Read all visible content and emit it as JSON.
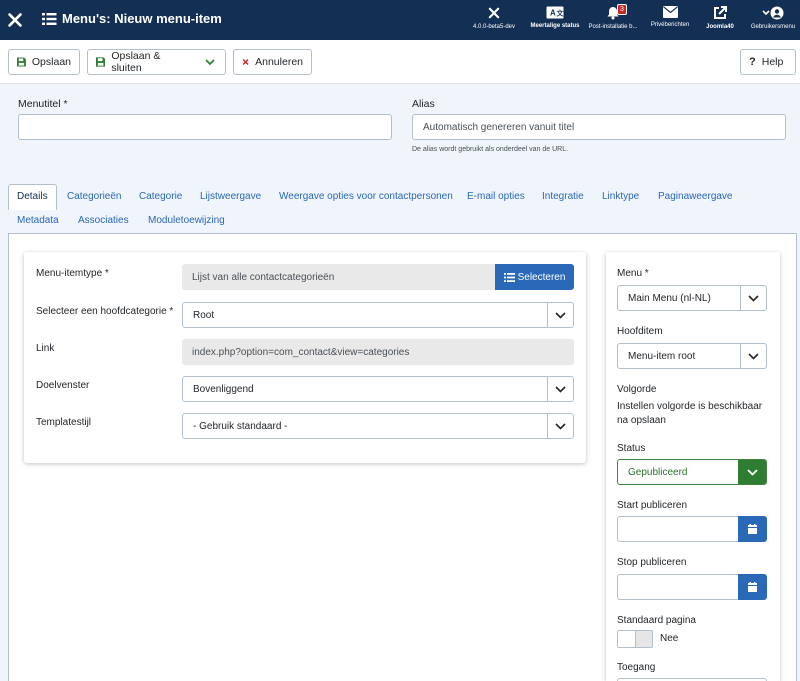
{
  "header": {
    "title": "Menu's: Nieuw menu-item",
    "items": [
      {
        "label": "4.0.0-beta5-dev"
      },
      {
        "label": "Meertalige status"
      },
      {
        "label": "Post-installatie b...",
        "badge": "3"
      },
      {
        "label": "Privéberichten"
      },
      {
        "label": "Joomla40"
      },
      {
        "label": "Gebruikersmenu"
      }
    ]
  },
  "toolbar": {
    "save": "Opslaan",
    "save_close": "Opslaan & sluiten",
    "cancel": "Annuleren",
    "help": "Help"
  },
  "form": {
    "menutitel_label": "Menutitel *",
    "menutitel_value": "",
    "alias_label": "Alias",
    "alias_placeholder": "Automatisch genereren vanuit titel",
    "alias_hint": "De alias wordt gebruikt als onderdeel van de URL."
  },
  "tabs": [
    "Details",
    "Categorieën",
    "Categorie",
    "Lijstweergave",
    "Weergave opties voor contactpersonen",
    "E-mail opties",
    "Integratie",
    "Linktype",
    "Paginaweergave",
    "Metadata",
    "Associaties",
    "Moduletoewijzing"
  ],
  "details": {
    "itemtype_label": "Menu-itemtype *",
    "itemtype_value": "Lijst van alle contactcategorieën",
    "select_button": "Selecteren",
    "parentcat_label": "Selecteer een hoofdcategorie *",
    "parentcat_value": "Root",
    "link_label": "Link",
    "link_value": "index.php?option=com_contact&view=categories",
    "target_label": "Doelvenster",
    "target_value": "Bovenliggend",
    "template_label": "Templatestijl",
    "template_value": "- Gebruik standaard -"
  },
  "sidebar": {
    "menu_label": "Menu *",
    "menu_value": "Main Menu (nl-NL)",
    "parent_label": "Hoofditem",
    "parent_value": "Menu-item root",
    "order_label": "Volgorde",
    "order_text": "Instellen volgorde is beschikbaar na opslaan",
    "status_label": "Status",
    "status_value": "Gepubliceerd",
    "start_label": "Start publiceren",
    "stop_label": "Stop publiceren",
    "default_label": "Standaard pagina",
    "default_value": "Nee",
    "access_label": "Toegang"
  },
  "colors": {
    "header": "#132f53",
    "accent": "#2a69b8",
    "success": "#2f7d32",
    "danger": "#c52827"
  }
}
